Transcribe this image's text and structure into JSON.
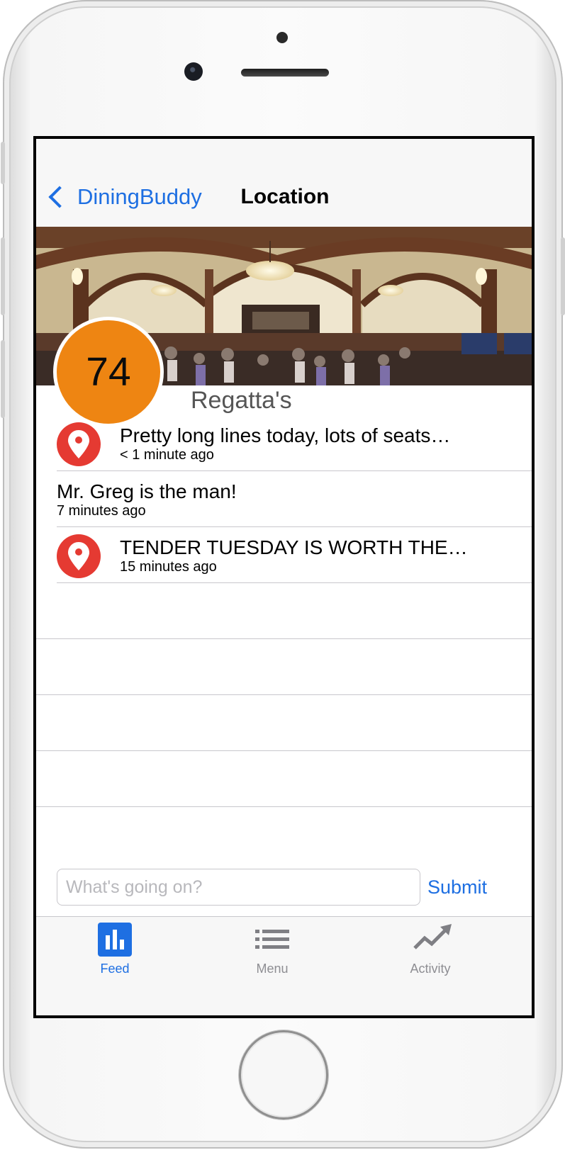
{
  "nav": {
    "back_label": "DiningBuddy",
    "title": "Location"
  },
  "location": {
    "score": "74",
    "name": "Regatta's"
  },
  "feed": [
    {
      "text": "Pretty long lines today, lots of seats…",
      "time": "< 1 minute ago",
      "pinned": true
    },
    {
      "text": "Mr. Greg is the man!",
      "time": "7 minutes ago",
      "pinned": false
    },
    {
      "text": "TENDER TUESDAY IS WORTH THE…",
      "time": "15 minutes ago",
      "pinned": true
    }
  ],
  "composer": {
    "placeholder": "What's going on?",
    "submit_label": "Submit"
  },
  "tabs": [
    {
      "label": "Feed",
      "icon": "bar-chart-icon",
      "active": true
    },
    {
      "label": "Menu",
      "icon": "list-icon",
      "active": false
    },
    {
      "label": "Activity",
      "icon": "trend-icon",
      "active": false
    }
  ],
  "colors": {
    "accent": "#1e6fe2",
    "score_badge": "#ee8512",
    "pin": "#e53a32"
  }
}
